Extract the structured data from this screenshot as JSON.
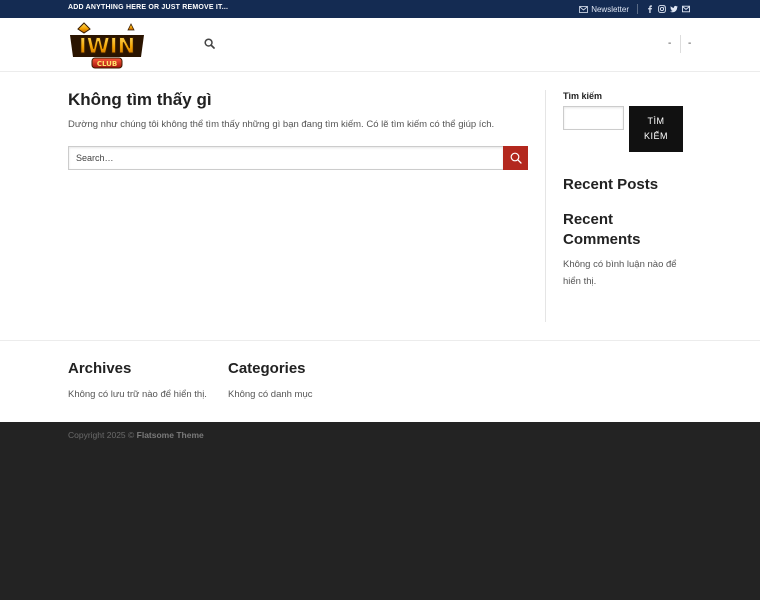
{
  "topbar": {
    "text": "ADD ANYTHING HERE OR JUST REMOVE IT...",
    "newsletter_label": "Newsletter",
    "icons": [
      "facebook-icon",
      "instagram-icon",
      "twitter-icon",
      "envelope-icon"
    ]
  },
  "header": {
    "logo_text": "IWIN",
    "logo_subtext": "CLUB",
    "nav_right_1": "-",
    "nav_right_2": "-"
  },
  "main": {
    "title": "Không tìm thấy gì",
    "description": "Dường như chúng tôi không thể tìm thấy những gì bạn đang tìm kiếm. Có lẽ tìm kiếm có thể giúp ích.",
    "search_placeholder": "Search…"
  },
  "sidebar": {
    "search_label": "Tìm kiếm",
    "search_button_line1": "TÌM",
    "search_button_line2": "KIẾM",
    "recent_posts_title": "Recent Posts",
    "recent_comments_title": "Recent Comments",
    "no_comments_text": "Không có bình luận nào để hiển thị."
  },
  "footer_widgets": {
    "archives_title": "Archives",
    "archives_text": "Không có lưu trữ nào để hiển thị.",
    "categories_title": "Categories",
    "categories_text": "Không có danh mục"
  },
  "footer": {
    "copyright_prefix": "Copyright 2025 ©",
    "theme_name": "Flatsome Theme"
  },
  "colors": {
    "topbar_bg": "#142b52",
    "search_button": "#b3281e",
    "footer_bg": "#232323"
  }
}
